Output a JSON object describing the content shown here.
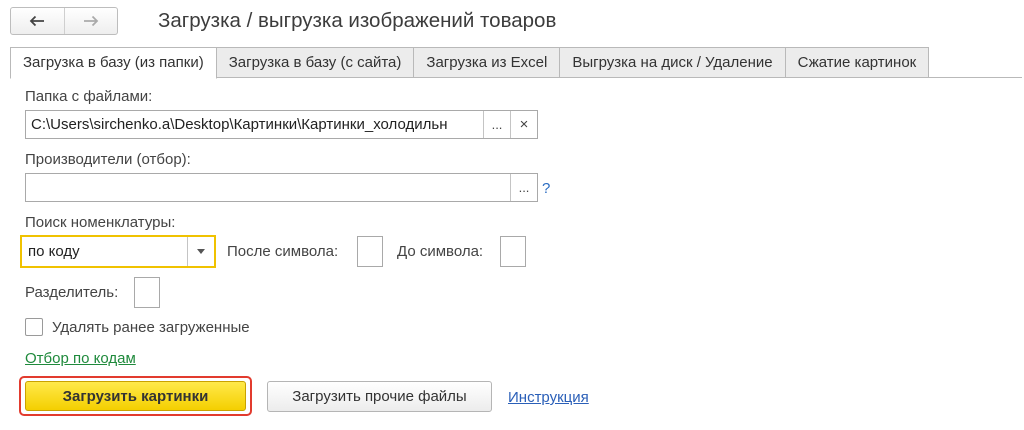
{
  "header": {
    "back_icon": "arrow-left-icon",
    "forward_icon": "arrow-right-icon",
    "title": "Загрузка / выгрузка изображений товаров"
  },
  "tabs": [
    {
      "label": "Загрузка в базу (из папки)",
      "active": true
    },
    {
      "label": "Загрузка в базу (с сайта)",
      "active": false
    },
    {
      "label": "Загрузка из Excel",
      "active": false
    },
    {
      "label": "Выгрузка на диск / Удаление",
      "active": false
    },
    {
      "label": "Сжатие картинок",
      "active": false
    }
  ],
  "folder": {
    "label": "Папка с файлами:",
    "value": "C:\\Users\\sirchenko.a\\Desktop\\Картинки\\Картинки_холодильн",
    "select_button": "...",
    "clear_button": "×"
  },
  "manufacturers": {
    "label": "Производители (отбор):",
    "value": "",
    "select_button": "...",
    "help": "?"
  },
  "search": {
    "label": "Поиск номенклатуры:",
    "value": "по коду",
    "after_label": "После символа:",
    "before_label": "До символа:"
  },
  "separator": {
    "label": "Разделитель:"
  },
  "delete_checkbox": {
    "label": "Удалять ранее загруженные",
    "checked": false
  },
  "filter_link": "Отбор по кодам",
  "buttons": {
    "load_images": "Загрузить картинки",
    "load_other": "Загрузить прочие файлы",
    "instruction": "Инструкция"
  },
  "colors": {
    "primary_button": "#f4cf00",
    "highlight_outline": "#e23b2e",
    "focus_border": "#f0c200",
    "link_green": "#1f8a3c",
    "link_blue": "#2a5fb8"
  }
}
